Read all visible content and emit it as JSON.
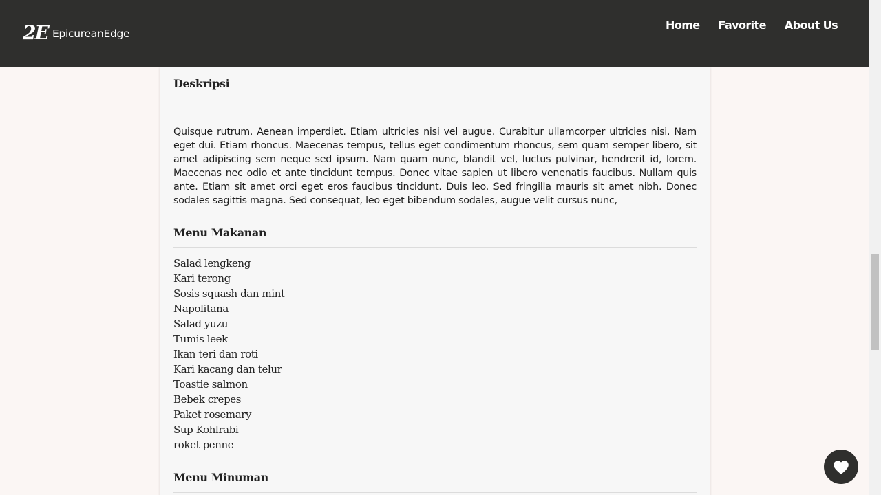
{
  "brand": {
    "logo_mark": "2E",
    "name": "EpicureanEdge"
  },
  "nav": {
    "items": [
      "Home",
      "Favorite",
      "About Us"
    ]
  },
  "detail": {
    "description_heading": "Deskripsi",
    "description_text": "Quisque rutrum. Aenean imperdiet. Etiam ultricies nisi vel augue. Curabitur ullamcorper ultricies nisi. Nam eget dui. Etiam rhoncus. Maecenas tempus, tellus eget condimentum rhoncus, sem quam semper libero, sit amet adipiscing sem neque sed ipsum. Nam quam nunc, blandit vel, luctus pulvinar, hendrerit id, lorem. Maecenas nec odio et ante tincidunt tempus. Donec vitae sapien ut libero venenatis faucibus. Nullam quis ante. Etiam sit amet orci eget eros faucibus tincidunt. Duis leo. Sed fringilla mauris sit amet nibh. Donec sodales sagittis magna. Sed consequat, leo eget bibendum sodales, augue velit cursus nunc,",
    "food_heading": "Menu Makanan",
    "foods": [
      "Salad lengkeng",
      "Kari terong",
      "Sosis squash dan mint",
      "Napolitana",
      "Salad yuzu",
      "Tumis leek",
      "Ikan teri dan roti",
      "Kari kacang dan telur",
      "Toastie salmon",
      "Bebek crepes",
      "Paket rosemary",
      "Sup Kohlrabi",
      "roket penne"
    ],
    "drink_heading": "Menu Minuman"
  },
  "fab": {
    "icon": "heart-icon"
  },
  "colors": {
    "navbar": "#2f2f2d",
    "page_background": "#fbf6f4",
    "card_background": "#f7f7f7"
  }
}
